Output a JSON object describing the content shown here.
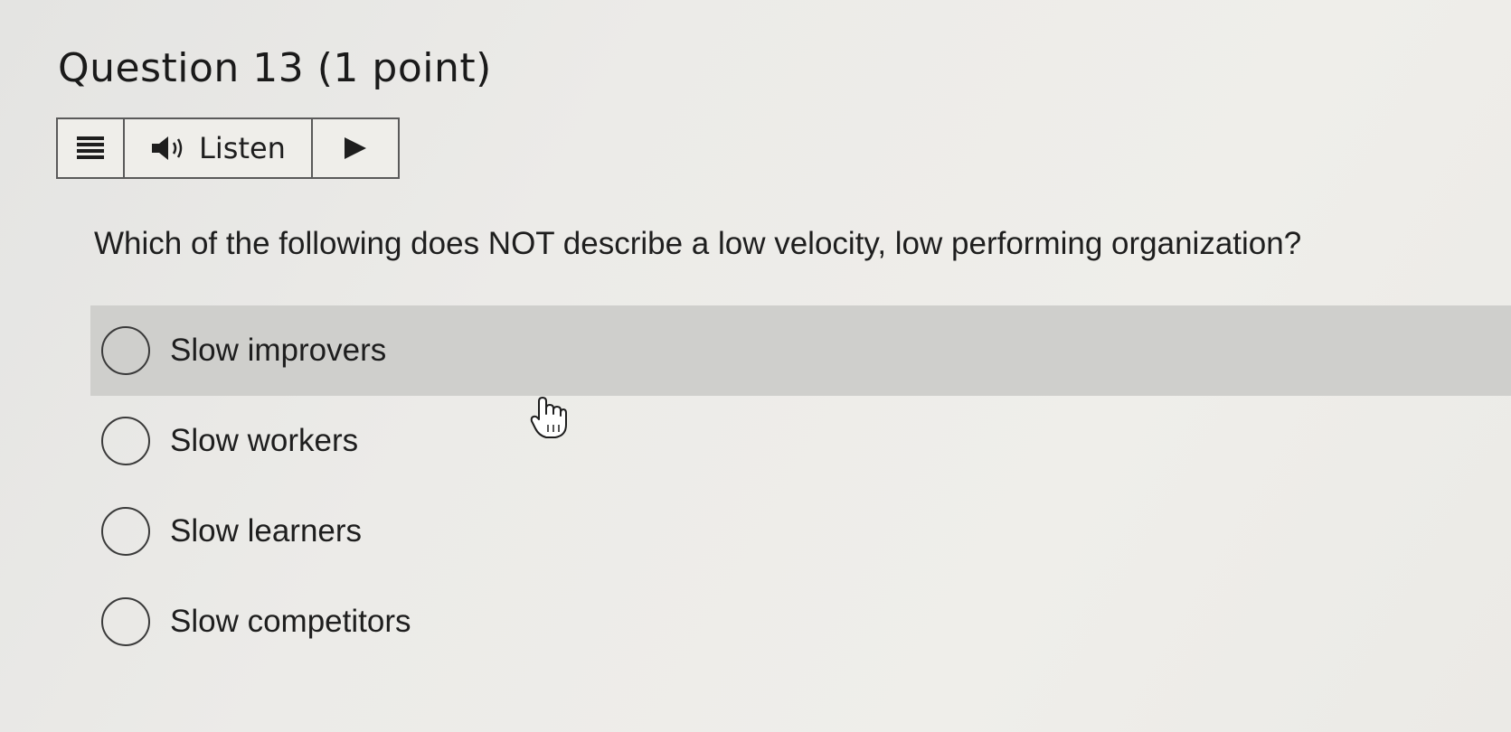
{
  "question": {
    "title": "Question 13 (1 point)",
    "text": "Which of the following does NOT describe a low velocity, low performing organization?"
  },
  "toolbar": {
    "menu_icon": "menu-icon",
    "speaker_icon": "speaker-icon",
    "listen_label": "Listen",
    "play_icon": "play-icon"
  },
  "options": [
    {
      "label": "Slow improvers",
      "selected": false,
      "hovered": true
    },
    {
      "label": "Slow workers",
      "selected": false,
      "hovered": false
    },
    {
      "label": "Slow learners",
      "selected": false,
      "hovered": false
    },
    {
      "label": "Slow competitors",
      "selected": false,
      "hovered": false
    }
  ],
  "colors": {
    "hover_row": "#cfcfcc",
    "text": "#1e1e1e",
    "border": "#5a5a5a"
  }
}
